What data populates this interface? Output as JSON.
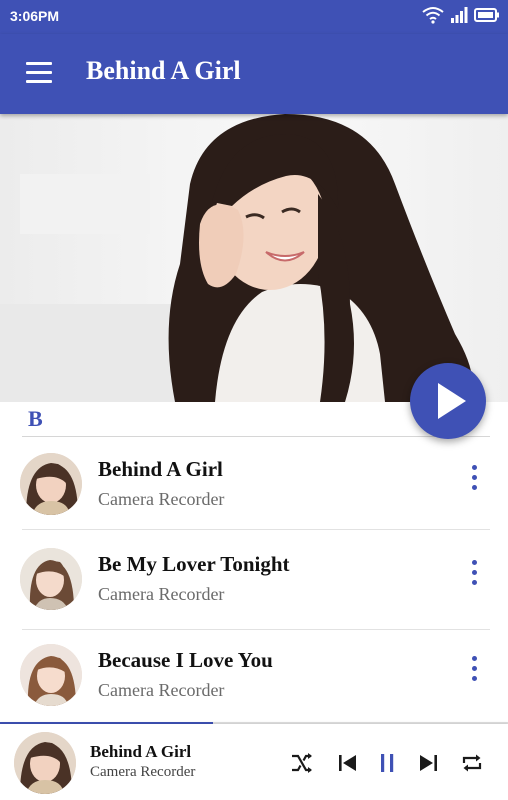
{
  "status_bar": {
    "time": "3:06PM"
  },
  "app_bar": {
    "title": "Behind A Girl"
  },
  "section": {
    "letter": "B"
  },
  "songs": [
    {
      "title": "Behind A Girl",
      "artist": "Camera Recorder"
    },
    {
      "title": "Be My Lover Tonight",
      "artist": "Camera Recorder"
    },
    {
      "title": "Because I Love You",
      "artist": "Camera Recorder"
    }
  ],
  "now_playing": {
    "title": "Behind A Girl",
    "artist": "Camera Recorder",
    "progress": 0.42,
    "state": "playing"
  },
  "colors": {
    "primary": "#3f51b5",
    "text": "#111111",
    "secondary_text": "#6a6a6a"
  },
  "icons": [
    "menu-icon",
    "wifi-icon",
    "signal-icon",
    "battery-icon",
    "play-icon",
    "more-vert-icon",
    "shuffle-icon",
    "skip-previous-icon",
    "pause-icon",
    "skip-next-icon",
    "repeat-icon"
  ]
}
